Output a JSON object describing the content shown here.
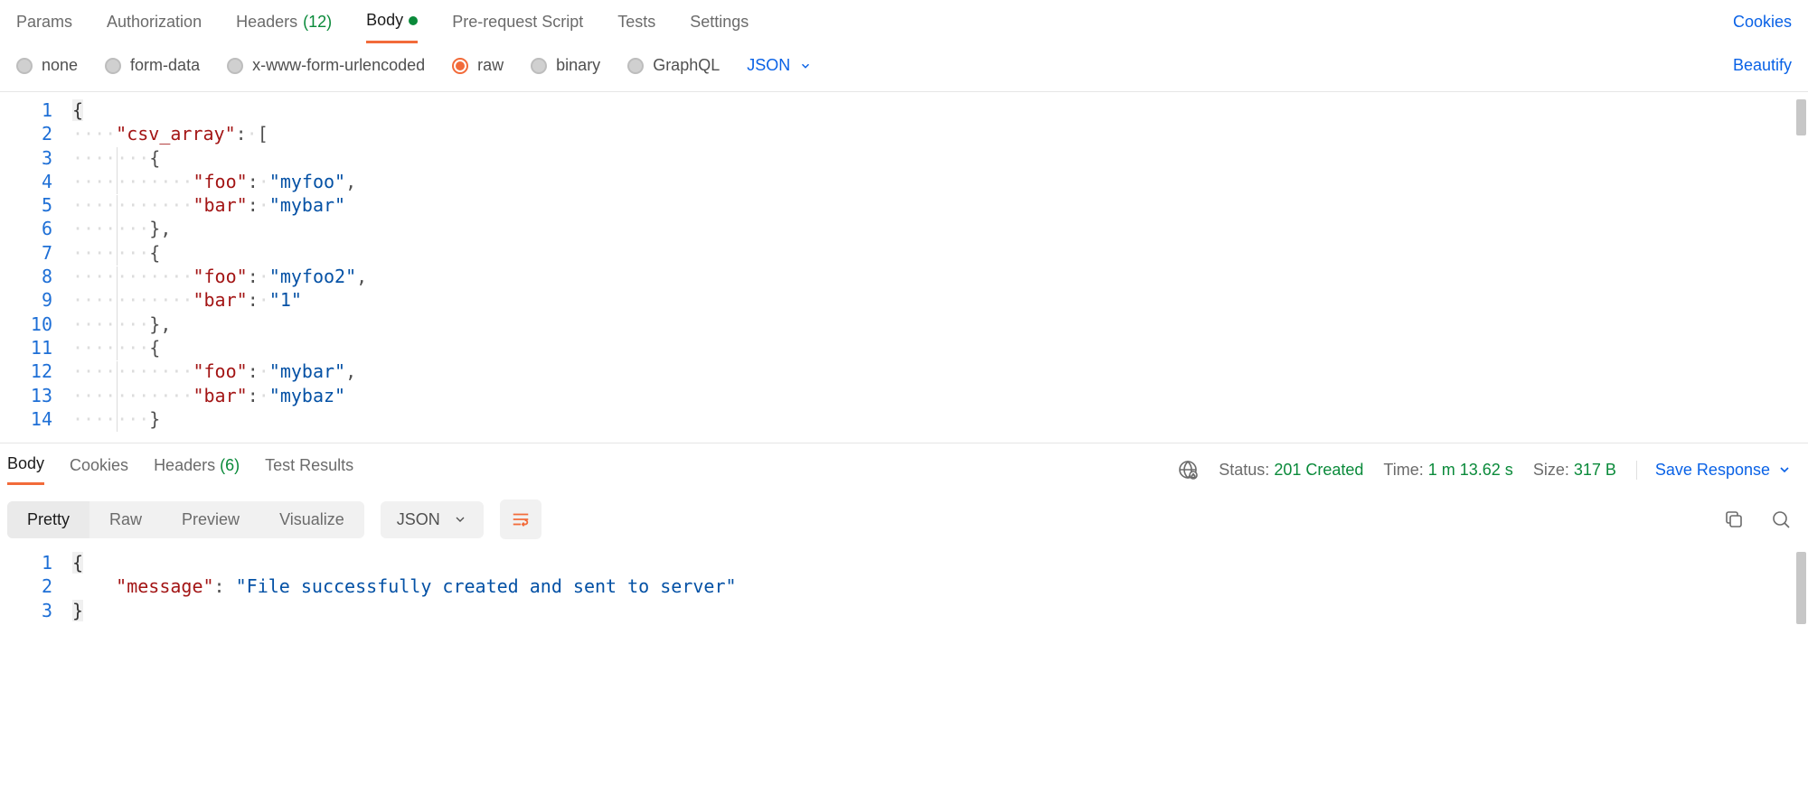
{
  "top_tabs": {
    "params": "Params",
    "authorization": "Authorization",
    "headers_label": "Headers",
    "headers_count": "(12)",
    "body": "Body",
    "pre_request": "Pre-request Script",
    "tests": "Tests",
    "settings": "Settings",
    "cookies": "Cookies"
  },
  "body_types": {
    "none": "none",
    "form_data": "form-data",
    "urlencoded": "x-www-form-urlencoded",
    "raw": "raw",
    "binary": "binary",
    "graphql": "GraphQL",
    "json_dd": "JSON",
    "beautify": "Beautify"
  },
  "request_body_lines": [
    {
      "n": "1",
      "tokens": [
        {
          "t": "brace",
          "v": "{"
        }
      ]
    },
    {
      "n": "2",
      "tokens": [
        {
          "t": "ws",
          "v": "····"
        },
        {
          "t": "key",
          "v": "\"csv_array\""
        },
        {
          "t": "plain",
          "v": ":"
        },
        {
          "t": "ws",
          "v": "·"
        },
        {
          "t": "plain",
          "v": "["
        }
      ]
    },
    {
      "n": "3",
      "tokens": [
        {
          "t": "ws",
          "v": "····"
        },
        {
          "t": "guide"
        },
        {
          "t": "ws",
          "v": "···"
        },
        {
          "t": "plain",
          "v": "{"
        }
      ]
    },
    {
      "n": "4",
      "tokens": [
        {
          "t": "ws",
          "v": "····"
        },
        {
          "t": "guide"
        },
        {
          "t": "ws",
          "v": "···"
        },
        {
          "t": "ws",
          "v": "····"
        },
        {
          "t": "key",
          "v": "\"foo\""
        },
        {
          "t": "plain",
          "v": ":"
        },
        {
          "t": "ws",
          "v": "·"
        },
        {
          "t": "str",
          "v": "\"myfoo\""
        },
        {
          "t": "plain",
          "v": ","
        }
      ]
    },
    {
      "n": "5",
      "tokens": [
        {
          "t": "ws",
          "v": "····"
        },
        {
          "t": "guide"
        },
        {
          "t": "ws",
          "v": "···"
        },
        {
          "t": "ws",
          "v": "····"
        },
        {
          "t": "key",
          "v": "\"bar\""
        },
        {
          "t": "plain",
          "v": ":"
        },
        {
          "t": "ws",
          "v": "·"
        },
        {
          "t": "str",
          "v": "\"mybar\""
        }
      ]
    },
    {
      "n": "6",
      "tokens": [
        {
          "t": "ws",
          "v": "····"
        },
        {
          "t": "guide"
        },
        {
          "t": "ws",
          "v": "···"
        },
        {
          "t": "plain",
          "v": "},"
        }
      ]
    },
    {
      "n": "7",
      "tokens": [
        {
          "t": "ws",
          "v": "····"
        },
        {
          "t": "guide"
        },
        {
          "t": "ws",
          "v": "···"
        },
        {
          "t": "plain",
          "v": "{"
        }
      ]
    },
    {
      "n": "8",
      "tokens": [
        {
          "t": "ws",
          "v": "····"
        },
        {
          "t": "guide"
        },
        {
          "t": "ws",
          "v": "···"
        },
        {
          "t": "ws",
          "v": "····"
        },
        {
          "t": "key",
          "v": "\"foo\""
        },
        {
          "t": "plain",
          "v": ":"
        },
        {
          "t": "ws",
          "v": "·"
        },
        {
          "t": "str",
          "v": "\"myfoo2\""
        },
        {
          "t": "plain",
          "v": ","
        }
      ]
    },
    {
      "n": "9",
      "tokens": [
        {
          "t": "ws",
          "v": "····"
        },
        {
          "t": "guide"
        },
        {
          "t": "ws",
          "v": "···"
        },
        {
          "t": "ws",
          "v": "····"
        },
        {
          "t": "key",
          "v": "\"bar\""
        },
        {
          "t": "plain",
          "v": ":"
        },
        {
          "t": "ws",
          "v": "·"
        },
        {
          "t": "str",
          "v": "\"1\""
        }
      ]
    },
    {
      "n": "10",
      "tokens": [
        {
          "t": "ws",
          "v": "····"
        },
        {
          "t": "guide"
        },
        {
          "t": "ws",
          "v": "···"
        },
        {
          "t": "plain",
          "v": "},"
        }
      ]
    },
    {
      "n": "11",
      "tokens": [
        {
          "t": "ws",
          "v": "····"
        },
        {
          "t": "guide"
        },
        {
          "t": "ws",
          "v": "···"
        },
        {
          "t": "plain",
          "v": "{"
        }
      ]
    },
    {
      "n": "12",
      "tokens": [
        {
          "t": "ws",
          "v": "····"
        },
        {
          "t": "guide"
        },
        {
          "t": "ws",
          "v": "···"
        },
        {
          "t": "ws",
          "v": "····"
        },
        {
          "t": "key",
          "v": "\"foo\""
        },
        {
          "t": "plain",
          "v": ":"
        },
        {
          "t": "ws",
          "v": "·"
        },
        {
          "t": "str",
          "v": "\"mybar\""
        },
        {
          "t": "plain",
          "v": ","
        }
      ]
    },
    {
      "n": "13",
      "tokens": [
        {
          "t": "ws",
          "v": "····"
        },
        {
          "t": "guide"
        },
        {
          "t": "ws",
          "v": "···"
        },
        {
          "t": "ws",
          "v": "····"
        },
        {
          "t": "key",
          "v": "\"bar\""
        },
        {
          "t": "plain",
          "v": ":"
        },
        {
          "t": "ws",
          "v": "·"
        },
        {
          "t": "str",
          "v": "\"mybaz\""
        }
      ]
    },
    {
      "n": "14",
      "tokens": [
        {
          "t": "ws",
          "v": "····"
        },
        {
          "t": "guide"
        },
        {
          "t": "ws",
          "v": "···"
        },
        {
          "t": "plain",
          "v": "}"
        }
      ]
    }
  ],
  "response_tabs": {
    "body": "Body",
    "cookies": "Cookies",
    "headers_label": "Headers",
    "headers_count": "(6)",
    "test_results": "Test Results"
  },
  "response_meta": {
    "status_label": "Status:",
    "status_value": "201 Created",
    "time_label": "Time:",
    "time_value": "1 m 13.62 s",
    "size_label": "Size:",
    "size_value": "317 B",
    "save_response": "Save Response"
  },
  "response_view": {
    "pretty": "Pretty",
    "raw": "Raw",
    "preview": "Preview",
    "visualize": "Visualize",
    "json_select": "JSON"
  },
  "response_body_lines": [
    {
      "n": "1",
      "tokens": [
        {
          "t": "brace",
          "v": "{"
        }
      ]
    },
    {
      "n": "2",
      "tokens": [
        {
          "t": "plain",
          "v": "    "
        },
        {
          "t": "key",
          "v": "\"message\""
        },
        {
          "t": "plain",
          "v": ": "
        },
        {
          "t": "str",
          "v": "\"File successfully created and sent to server\""
        }
      ]
    },
    {
      "n": "3",
      "tokens": [
        {
          "t": "brace",
          "v": "}"
        }
      ]
    }
  ]
}
